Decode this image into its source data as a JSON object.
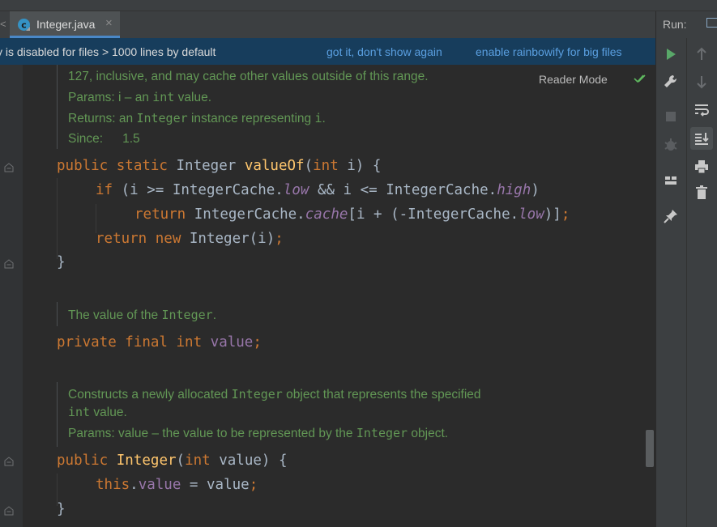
{
  "tab": {
    "file_name": "Integer.java",
    "close_glyph": "×",
    "left_arrow": "<"
  },
  "banner": {
    "message": "y is disabled for files > 1000 lines by default",
    "got_it": "got it, don't show again",
    "enable": "enable rainbowify for big files"
  },
  "reader_mode": "Reader Mode",
  "run": {
    "title": "Run:"
  },
  "doc1": {
    "line1": "127, inclusive, and may cache other values outside of this range.",
    "params_label": "Params: i – an ",
    "params_code": "int",
    "params_rest": " value.",
    "returns_label": "Returns: an ",
    "returns_code": "Integer",
    "returns_rest": " instance representing ",
    "returns_i": "i",
    "returns_end": ".",
    "since_label": "Since:",
    "since_value": "1.5"
  },
  "code1": {
    "l1_kw": "public static ",
    "l1_type": "Integer ",
    "l1_fn": "valueOf",
    "l1_p1": "(",
    "l1_int": "int",
    "l1_rest": " i) {",
    "l2_if": "if",
    "l2_a": " (i >= IntegerCache.",
    "l2_low": "low",
    "l2_b": " && i <= IntegerCache.",
    "l2_high": "high",
    "l2_c": ")",
    "l3_ret": "return",
    "l3_a": " IntegerCache.",
    "l3_cache": "cache",
    "l3_b": "[i + (-IntegerCache.",
    "l3_low": "low",
    "l3_c": ")]",
    "l3_semi": ";",
    "l4_ret": "return new",
    "l4_a": " Integer(i)",
    "l4_semi": ";",
    "l5": "}"
  },
  "doc2": {
    "text": "The value of the ",
    "code": "Integer",
    "end": "."
  },
  "code2": {
    "kw": "private final int ",
    "field": "value",
    "semi": ";"
  },
  "doc3": {
    "line1_a": "Constructs a newly allocated ",
    "line1_code": "Integer",
    "line1_b": " object that represents the specified",
    "line2_code": "int",
    "line2_b": " value.",
    "params_a": "Params: value – the value to be represented by the ",
    "params_code": "Integer",
    "params_b": " object."
  },
  "code3": {
    "l1_kw": "public ",
    "l1_fn": "Integer",
    "l1_p": "(",
    "l1_int": "int",
    "l1_rest": " value) {",
    "l2_this": "this",
    "l2_dot": ".",
    "l2_field": "value",
    "l2_rest": " = value",
    "l2_semi": ";",
    "l3": "}"
  }
}
